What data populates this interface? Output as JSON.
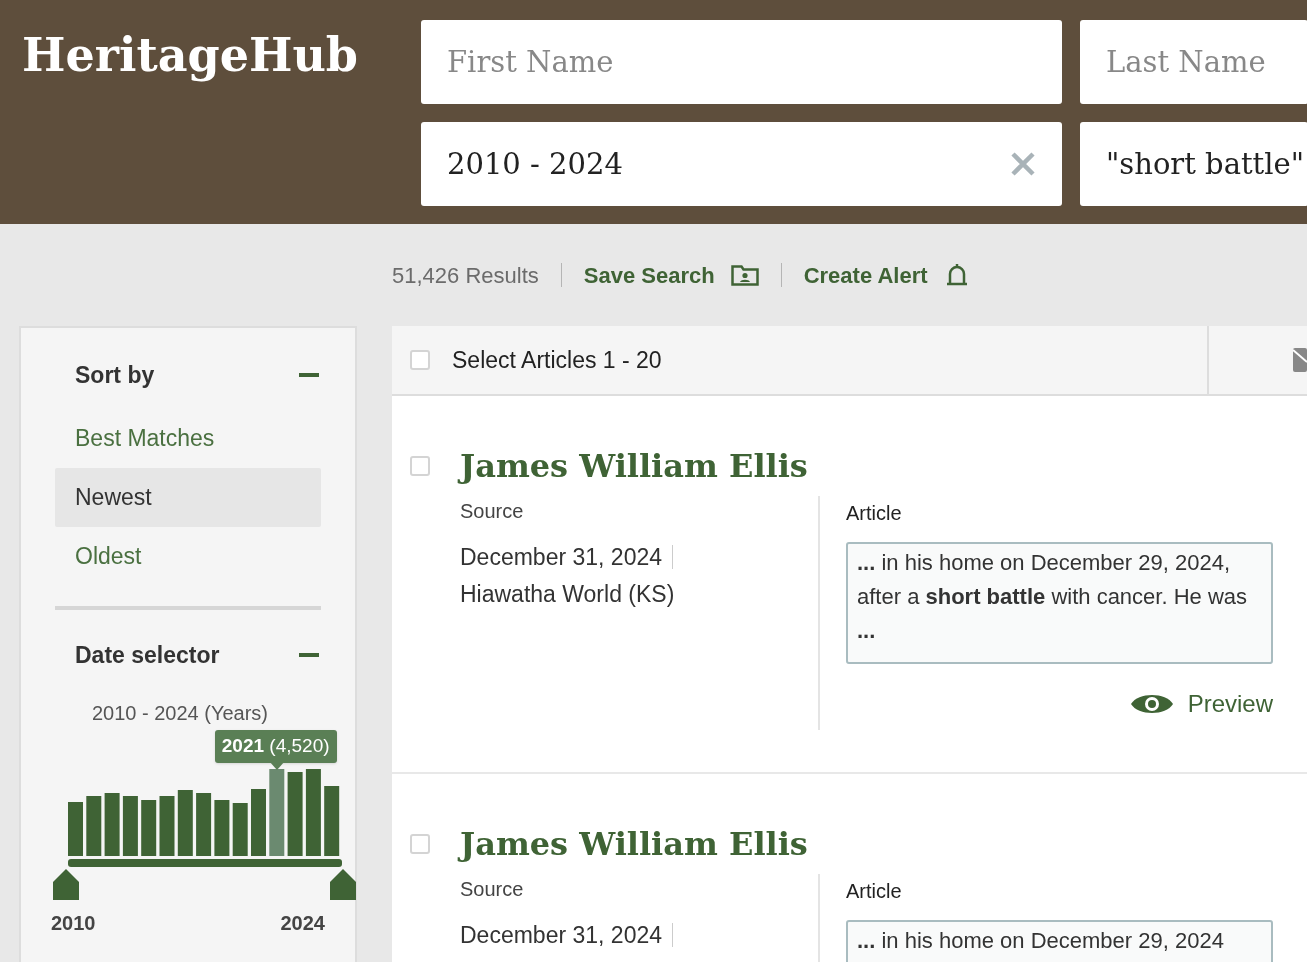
{
  "logo": "HeritageHub",
  "search": {
    "fields": [
      {
        "placeholder": "First Name"
      },
      {
        "placeholder": "Last Name"
      },
      {
        "value": "2010 - 2024",
        "clearable": true
      },
      {
        "value": "\"short battle\"",
        "clearable": false
      }
    ]
  },
  "results_bar": {
    "count": "51,426 Results",
    "actions": [
      {
        "label": "Save Search",
        "kind": "save"
      },
      {
        "label": "Create Alert",
        "kind": "alert"
      }
    ]
  },
  "sidebar": {
    "sections": [
      {
        "kind": "sort",
        "title": "Sort by",
        "expanded": true,
        "options": [
          {
            "label": "Best Matches",
            "selected": false
          },
          {
            "label": "Newest",
            "selected": true
          },
          {
            "label": "Oldest",
            "selected": false
          }
        ]
      },
      {
        "kind": "date",
        "title": "Date selector",
        "expanded": true,
        "range_label": "2010 - 2024 (Years)",
        "tooltip": "**2021** (4,520)",
        "min_label": "2010",
        "max_label": "2024",
        "bars": [
          {
            "selected": false
          },
          {
            "selected": false
          },
          {
            "selected": false
          },
          {
            "selected": false
          },
          {
            "selected": false
          },
          {
            "selected": false
          },
          {
            "selected": false
          },
          {
            "selected": false
          },
          {
            "selected": false
          },
          {
            "selected": false
          },
          {
            "selected": false
          },
          {
            "selected": true
          },
          {
            "selected": false
          },
          {
            "selected": false
          },
          {
            "selected": false
          }
        ]
      }
    ]
  },
  "list": {
    "select_all": {
      "label": "Select Articles 1 - 20",
      "checked": false
    },
    "articles": [
      {
        "checked": false,
        "title": "James William Ellis",
        "source_label": "Source",
        "date": "December 31, 2024",
        "publication": "Hiawatha World (KS)",
        "article_label": "Article",
        "snippet": "**...** in his home on December 29, 2024, after a **short battle** with cancer. He was **...**",
        "preview": "Preview"
      },
      {
        "checked": false,
        "title": "James William Ellis",
        "source_label": "Source",
        "date": "December 31, 2024",
        "article_label": "Article",
        "snippet": "**...** in his home on December 29, 2024"
      }
    ]
  }
}
